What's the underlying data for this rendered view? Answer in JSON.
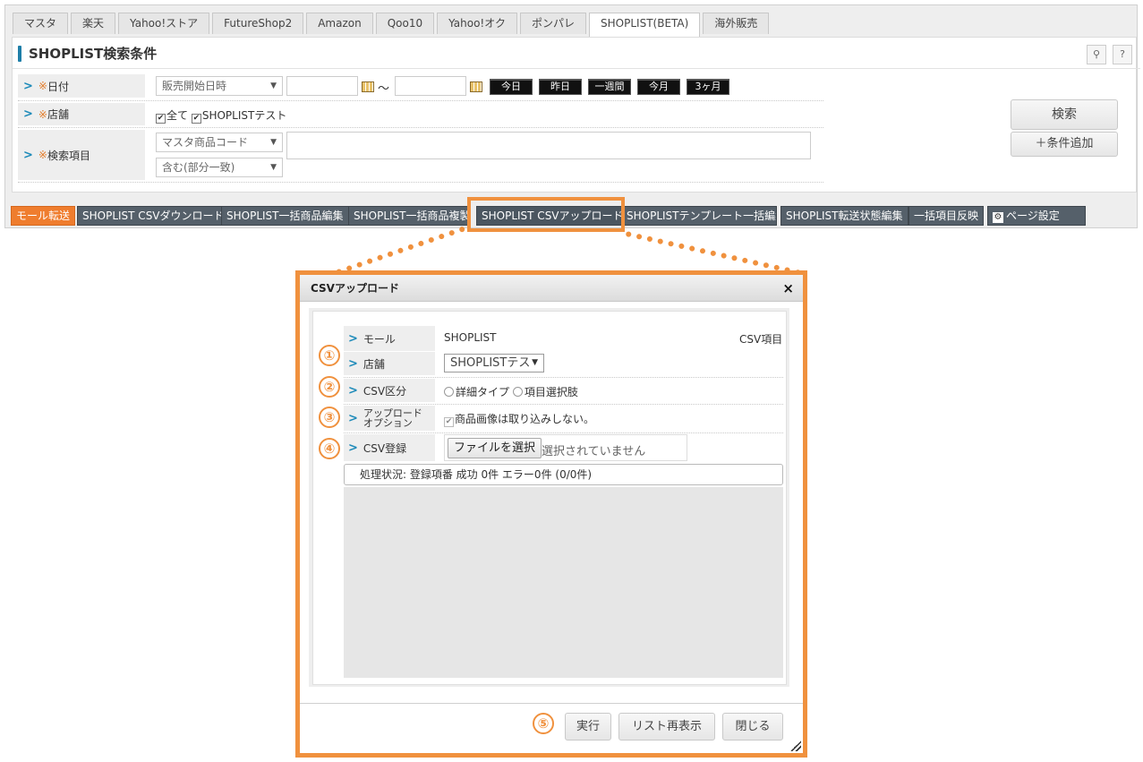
{
  "tabs": [
    "マスタ",
    "楽天",
    "Yahoo!ストア",
    "FutureShop2",
    "Amazon",
    "Qoo10",
    "Yahoo!オク",
    "ポンパレ",
    "SHOPLIST(BETA)",
    "海外販売"
  ],
  "search_panel": {
    "title": "SHOPLIST検索条件",
    "search_icon": "magnifier-icon",
    "help_label": "?",
    "date": {
      "label": "日付",
      "required_mark": "※",
      "type_select": "販売開始日時",
      "range_sep": "～",
      "quick_buttons": [
        "今日",
        "昨日",
        "一週間",
        "今月",
        "3ヶ月"
      ]
    },
    "shop": {
      "label": "店舗",
      "required_mark": "※",
      "all_label": "全て",
      "shop_label": "SHOPLISTテスト"
    },
    "search_item": {
      "label": "検索項目",
      "required_mark": "※",
      "field_select": "マスタ商品コード",
      "match_select": "含む(部分一致)"
    },
    "search_button": "検索",
    "add_condition_button": "＋条件追加"
  },
  "action_bar": [
    "モール転送",
    "SHOPLIST CSVダウンロード",
    "SHOPLIST一括商品編集",
    "SHOPLIST一括商品複製",
    "SHOPLIST CSVアップロード",
    "SHOPLISTテンプレート一括編集",
    "SHOPLIST転送状態編集",
    "一括項目反映",
    "ページ設定"
  ],
  "modal": {
    "title": "CSVアップロード",
    "close": "×",
    "mall_label": "モール",
    "mall_value": "SHOPLIST",
    "csv_items_label": "CSV項目",
    "shop_label": "店舗",
    "shop_value": "SHOPLISTテス",
    "csv_type_label": "CSV区分",
    "csv_type_options": [
      "詳細タイプ",
      "項目選択肢"
    ],
    "upload_option_label": "アップロードオプション",
    "upload_option_label_line1": "アップロード",
    "upload_option_label_line2": "オプション",
    "upload_option_checkbox": "商品画像は取り込みしない。",
    "csv_register_label": "CSV登録",
    "choose_file_button": "ファイルを選択",
    "no_file_text": "選択されていません",
    "status_text": "処理状況: 登録項番 成功 0件 エラー0件 (0/0件)",
    "run_button": "実行",
    "refresh_button": "リスト再表示",
    "close_button": "閉じる"
  },
  "markers": [
    "①",
    "②",
    "③",
    "④",
    "⑤"
  ],
  "colors": {
    "accent_orange": "#f0913e",
    "title_blue": "#1e7ea8",
    "action_button": "#55606a",
    "mall_transfer": "#ef7d2e"
  }
}
